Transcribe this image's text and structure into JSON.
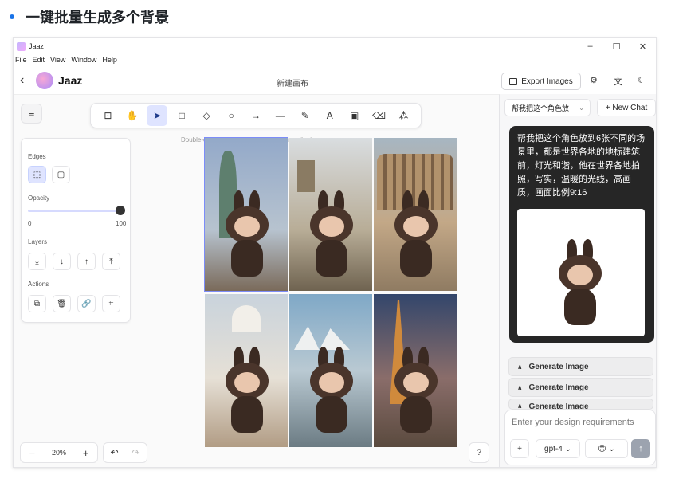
{
  "heading": "一键批量生成多个背景",
  "window": {
    "title": "Jaaz",
    "controls": {
      "minimize": "–",
      "maximize": "☐",
      "close": "✕"
    }
  },
  "menu": [
    "File",
    "Edit",
    "View",
    "Window",
    "Help"
  ],
  "appbar": {
    "back": "‹",
    "brand": "Jaaz",
    "document_title": "新建画布",
    "export_label": "Export Images"
  },
  "toolbar": {
    "tools": [
      {
        "name": "lock-tool",
        "glyph": "⊡"
      },
      {
        "name": "hand-tool",
        "glyph": "✋"
      },
      {
        "name": "select-tool",
        "glyph": "➤",
        "active": true
      },
      {
        "name": "rectangle-tool",
        "glyph": "□"
      },
      {
        "name": "diamond-tool",
        "glyph": "◇"
      },
      {
        "name": "ellipse-tool",
        "glyph": "○"
      },
      {
        "name": "arrow-tool",
        "glyph": "→"
      },
      {
        "name": "line-tool",
        "glyph": "—"
      },
      {
        "name": "pencil-tool",
        "glyph": "✎"
      },
      {
        "name": "text-tool",
        "glyph": "A"
      },
      {
        "name": "image-tool",
        "glyph": "▣"
      },
      {
        "name": "eraser-tool",
        "glyph": "⌫"
      },
      {
        "name": "shapes-tool",
        "glyph": "⁂"
      }
    ]
  },
  "canvas": {
    "hint": "Double-click image or press Enter to crop the image",
    "menu_glyph": "≡"
  },
  "properties": {
    "edges_label": "Edges",
    "opacity_label": "Opacity",
    "opacity_min": "0",
    "opacity_max": "100",
    "opacity_value": 100,
    "layers_label": "Layers",
    "actions_label": "Actions"
  },
  "zoom": {
    "minus": "−",
    "value": "20%",
    "plus": "+"
  },
  "history": {
    "undo": "↶",
    "redo": "↷"
  },
  "help": "?",
  "chat": {
    "selector_label": "帮我把这个角色放",
    "new_chat_label": "+ New Chat",
    "message": "帮我把这个角色放到6张不同的场景里，都是世界各地的地标建筑前，灯光和谐，他在世界各地拍照，写实，温暖的光线，高画质，画面比例9:16",
    "generate_rows": [
      "Generate Image",
      "Generate Image",
      "Generate Image"
    ],
    "input_placeholder": "Enter your design requirements",
    "model_label": "gpt-4",
    "add_label": "+",
    "send_label": "↑"
  },
  "colors": {
    "accent": "#1a73e8",
    "tool_active": "#dfe4ff",
    "bubble_bg": "#262626"
  }
}
